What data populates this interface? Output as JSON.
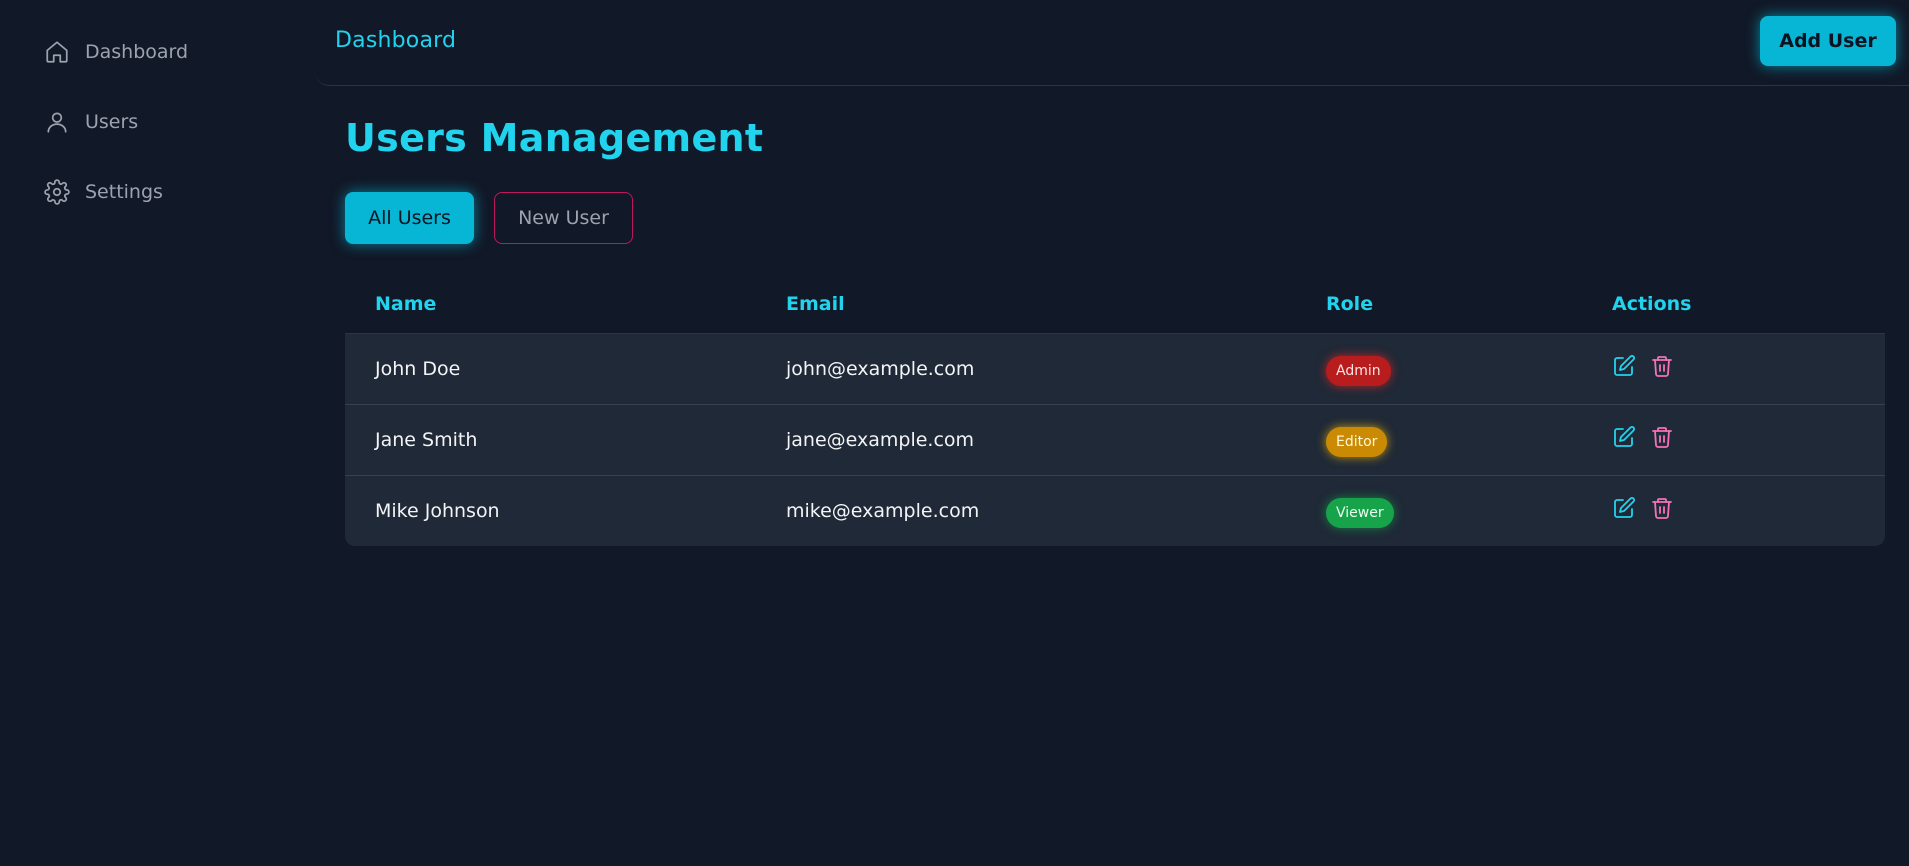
{
  "sidebar": {
    "items": [
      {
        "label": "Dashboard",
        "icon": "home-icon"
      },
      {
        "label": "Users",
        "icon": "user-icon"
      },
      {
        "label": "Settings",
        "icon": "gear-icon"
      }
    ]
  },
  "header": {
    "title": "Dashboard",
    "add_user_label": "Add User"
  },
  "main": {
    "title": "Users Management",
    "tabs": [
      {
        "label": "All Users",
        "active": true
      },
      {
        "label": "New User",
        "active": false
      }
    ],
    "table": {
      "columns": [
        "Name",
        "Email",
        "Role",
        "Actions"
      ],
      "rows": [
        {
          "name": "John Doe",
          "email": "john@example.com",
          "role": "Admin"
        },
        {
          "name": "Jane Smith",
          "email": "jane@example.com",
          "role": "Editor"
        },
        {
          "name": "Mike Johnson",
          "email": "mike@example.com",
          "role": "Viewer"
        }
      ]
    }
  },
  "colors": {
    "background": "#111827",
    "accent": "#22d3ee",
    "button": "#06b6d4",
    "admin": "#b91c1c",
    "editor": "#ca8a04",
    "viewer": "#16a34a",
    "delete_icon": "#f472b6"
  }
}
